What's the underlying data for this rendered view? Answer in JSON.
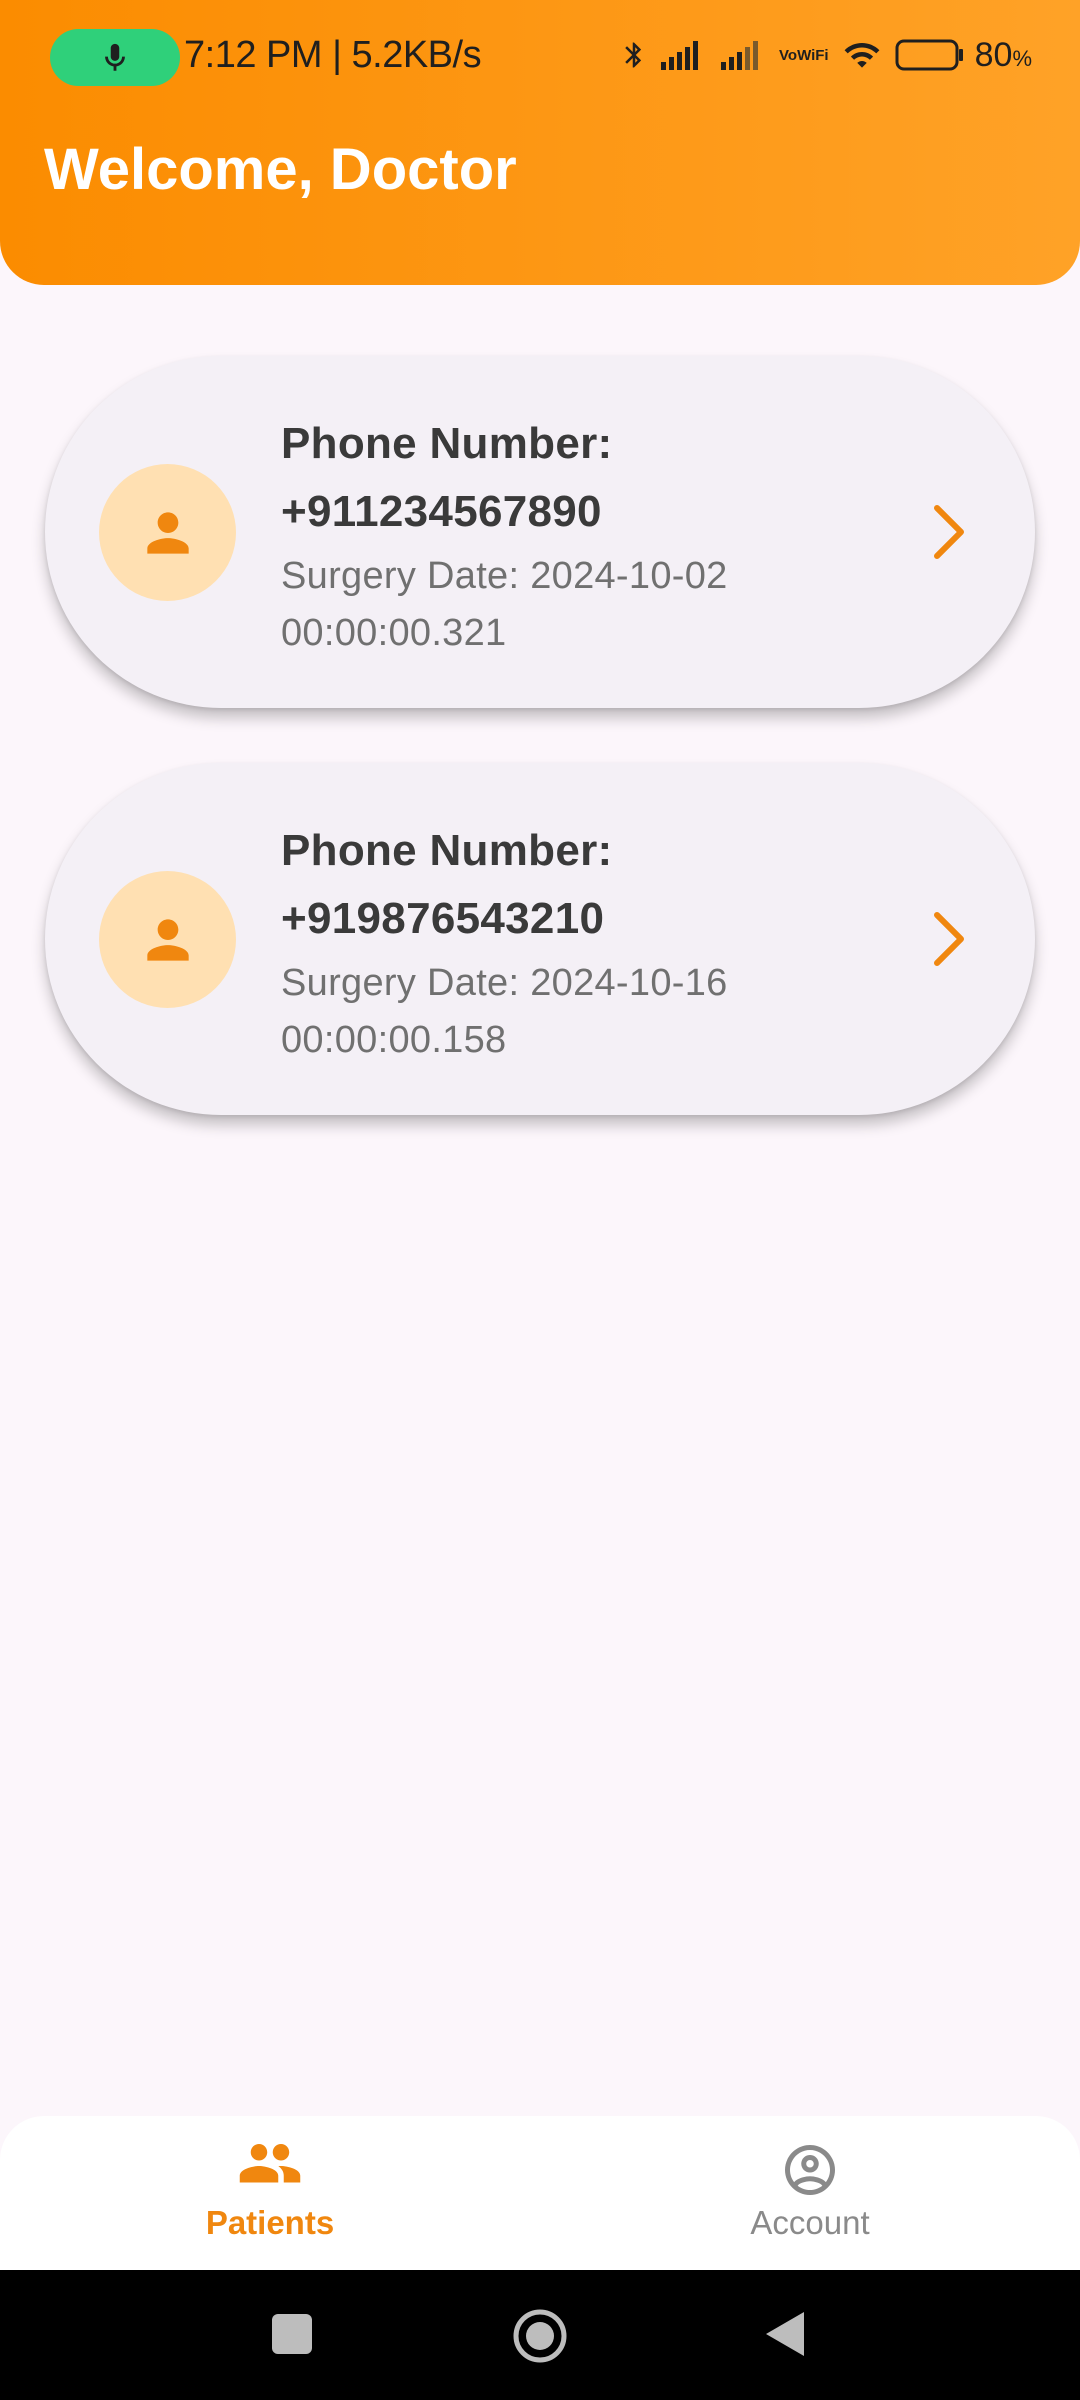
{
  "status_bar": {
    "time": "7:12 PM | 5.2KB/s",
    "vowifi_line1": "Vo",
    "vowifi_line2": "WiFi",
    "battery_percent": "80",
    "battery_percent_sign": "%",
    "battery_level": 0.8,
    "icons": [
      "mic-icon",
      "bluetooth-icon",
      "signal-icon",
      "signal-icon",
      "vowifi-icon",
      "wifi-icon",
      "battery-icon"
    ],
    "mic_pill_color": "#2fd07a"
  },
  "header": {
    "title": "Welcome, Doctor",
    "gradient_start": "#fb8c00",
    "gradient_end": "#ffa227"
  },
  "patients": [
    {
      "phone_label": "Phone Number:",
      "phone": "+911234567890",
      "surgery_line1": "Surgery Date: 2024-10-02",
      "surgery_line2": "00:00:00.321"
    },
    {
      "phone_label": "Phone Number:",
      "phone": "+919876543210",
      "surgery_line1": "Surgery Date: 2024-10-16",
      "surgery_line2": "00:00:00.158"
    }
  ],
  "bottom_nav": {
    "items": [
      {
        "label": "Patients",
        "icon": "people-icon",
        "active": true
      },
      {
        "label": "Account",
        "icon": "account-circle-icon",
        "active": false
      }
    ],
    "active_color": "#f0870f",
    "inactive_color": "#8a8a8a"
  },
  "system_nav": {
    "icons": [
      "recents-square-icon",
      "home-circle-icon",
      "back-triangle-icon"
    ]
  },
  "colors": {
    "accent": "#f0870f",
    "background": "#fcf6fb",
    "card": "#f4f0f6",
    "avatar_bg": "#ffe0b2"
  }
}
